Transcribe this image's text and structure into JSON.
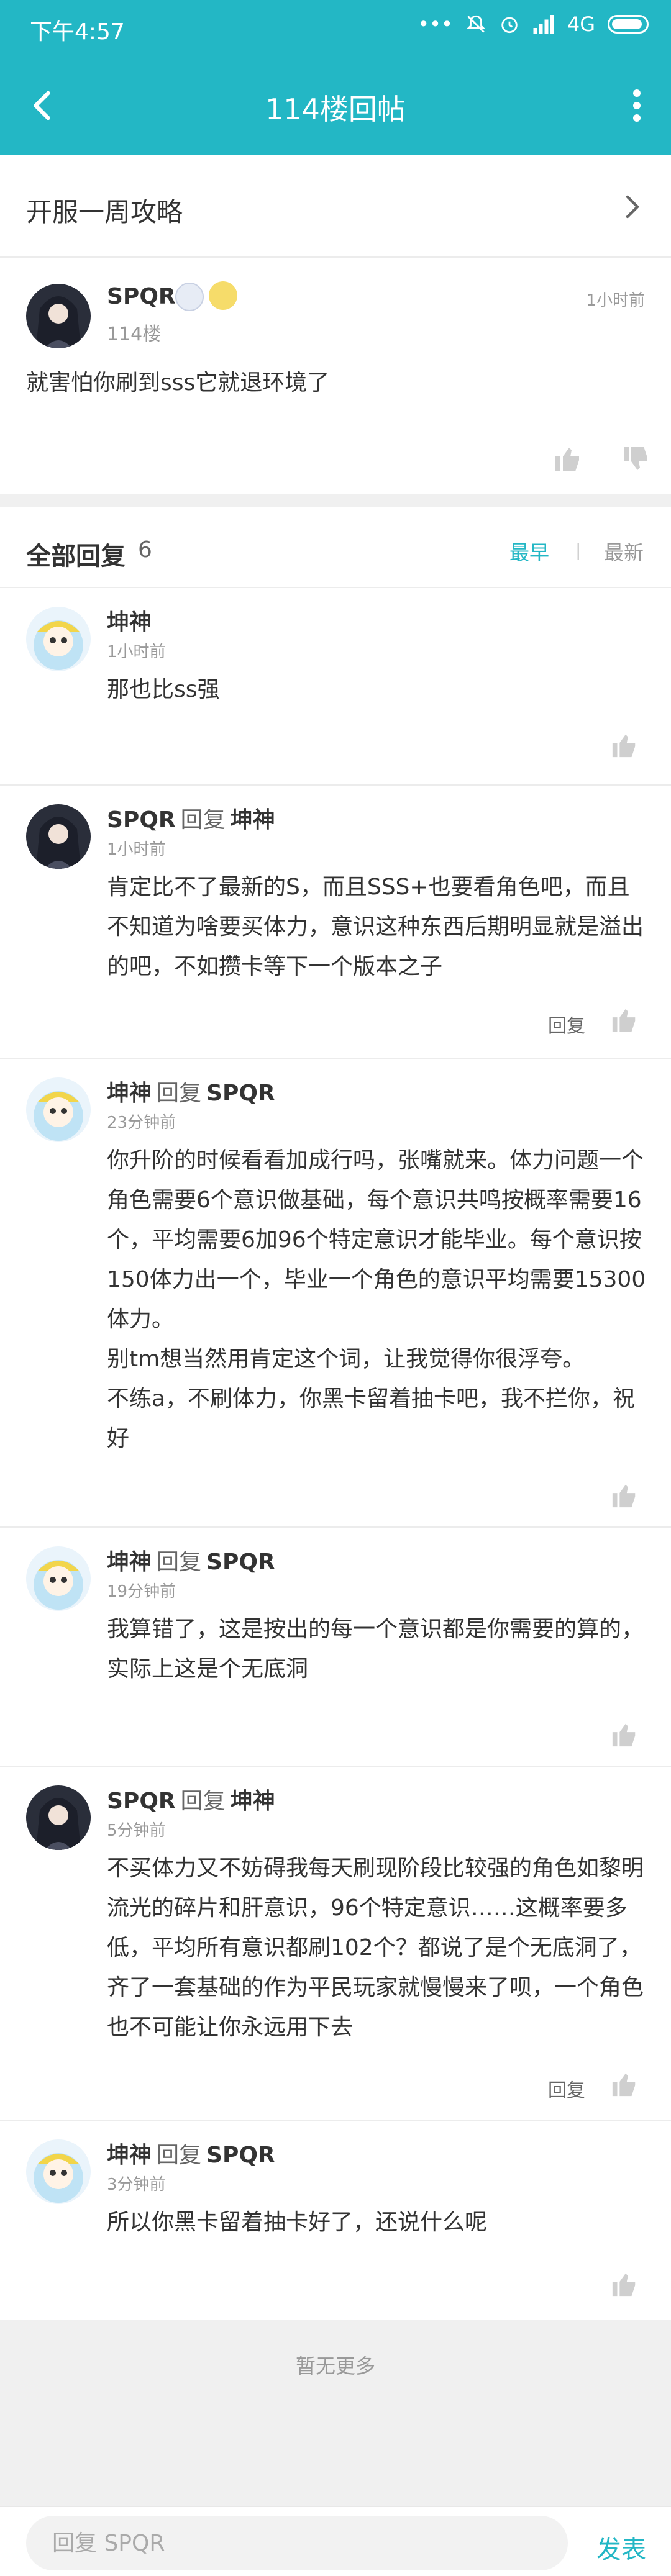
{
  "status_bar": {
    "time": "下午4:57",
    "network": "4G"
  },
  "app_bar": {
    "title": "114楼回帖"
  },
  "topic": {
    "label": "开服一周攻略"
  },
  "main_post": {
    "username": "SPQR",
    "floor": "114楼",
    "time": "1小时前",
    "content": "就害怕你刷到sss它就退环境了"
  },
  "replies_header": {
    "title": "全部回复",
    "count": "6",
    "sort_earliest": "最早",
    "sort_latest": "最新"
  },
  "replies": [
    {
      "user": "坤神",
      "connector": "",
      "target": "",
      "time": "1小时前",
      "text": "那也比ss强",
      "has_reply_button": false,
      "avatar": "light"
    },
    {
      "user": "SPQR",
      "connector": "回复",
      "target": "坤神",
      "time": "1小时前",
      "text": "肯定比不了最新的S，而且SSS+也要看角色吧，而且不知道为啥要买体力，意识这种东西后期明显就是溢出的吧，不如攒卡等下一个版本之子",
      "has_reply_button": true,
      "avatar": "dark"
    },
    {
      "user": "坤神",
      "connector": "回复",
      "target": "SPQR",
      "time": "23分钟前",
      "text": "你升阶的时候看看加成行吗，张嘴就来。体力问题一个角色需要6个意识做基础，每个意识共鸣按概率需要16个，平均需要6加96个特定意识才能毕业。每个意识按150体力出一个，毕业一个角色的意识平均需要15300体力。\n别tm想当然用肯定这个词，让我觉得你很浮夸。\n不练a，不刷体力，你黑卡留着抽卡吧，我不拦你，祝好",
      "has_reply_button": false,
      "avatar": "light"
    },
    {
      "user": "坤神",
      "connector": "回复",
      "target": "SPQR",
      "time": "19分钟前",
      "text": "我算错了，这是按出的每一个意识都是你需要的算的，实际上这是个无底洞",
      "has_reply_button": false,
      "avatar": "light"
    },
    {
      "user": "SPQR",
      "connector": "回复",
      "target": "坤神",
      "time": "5分钟前",
      "text": "不买体力又不妨碍我每天刷现阶段比较强的角色如黎明流光的碎片和肝意识，96个特定意识……这概率要多低，平均所有意识都刷102个？都说了是个无底洞了，齐了一套基础的作为平民玩家就慢慢来了呗，一个角色也不可能让你永远用下去",
      "has_reply_button": true,
      "avatar": "dark"
    },
    {
      "user": "坤神",
      "connector": "回复",
      "target": "SPQR",
      "time": "3分钟前",
      "text": "所以你黑卡留着抽卡好了，还说什么呢",
      "has_reply_button": false,
      "avatar": "light"
    }
  ],
  "reply_button_label": "回复",
  "no_more": "暂无更多",
  "composer": {
    "placeholder": "回复 SPQR",
    "send_label": "发表"
  },
  "colors": {
    "accent": "#23b7c5",
    "text": "#333333",
    "muted": "#999999"
  }
}
